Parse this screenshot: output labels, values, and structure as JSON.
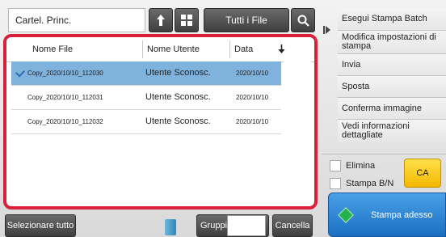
{
  "header": {
    "folder_label": "Cartel. Princ.",
    "back_icon": "up-arrow-icon",
    "grid_icon": "grid-view-icon",
    "filter_button": "Tutti i File",
    "search_icon": "search-icon"
  },
  "table": {
    "columns": [
      "Nome File",
      "Nome Utente",
      "Data"
    ],
    "sort_icon": "sort-descending-icon",
    "rows": [
      {
        "file": "Copy_2020/10/10_112030",
        "user": "Utente Sconosc.",
        "date": "2020/10/10",
        "selected": true
      },
      {
        "file": "Copy_2020/10/10_112031",
        "user": "Utente Sconosc.",
        "date": "2020/10/10",
        "selected": false
      },
      {
        "file": "Copy_2020/10/10_112032",
        "user": "Utente Sconosc.",
        "date": "2020/10/10",
        "selected": false
      }
    ]
  },
  "bottom": {
    "select_all": "Selezionare tutto",
    "group": "Gruppi",
    "cancel": "Cancella"
  },
  "side": {
    "arrow_icon": "expand-right-icon",
    "items": [
      "Esegui Stampa Batch",
      "Modifica impostazioni di stampa",
      "Invia",
      "Sposta",
      "Conferma immagine",
      "Vedi informazioni dettagliate"
    ],
    "delete_label": "Elimina",
    "bw_label": "Stampa B/N",
    "ca_label": "CA",
    "print_now": "Stampa adesso"
  },
  "colors": {
    "accent_red": "#d8203a",
    "selected_row": "#7fb2dc",
    "print_button": "#2a86d8",
    "ca_button": "#f7c51c"
  }
}
